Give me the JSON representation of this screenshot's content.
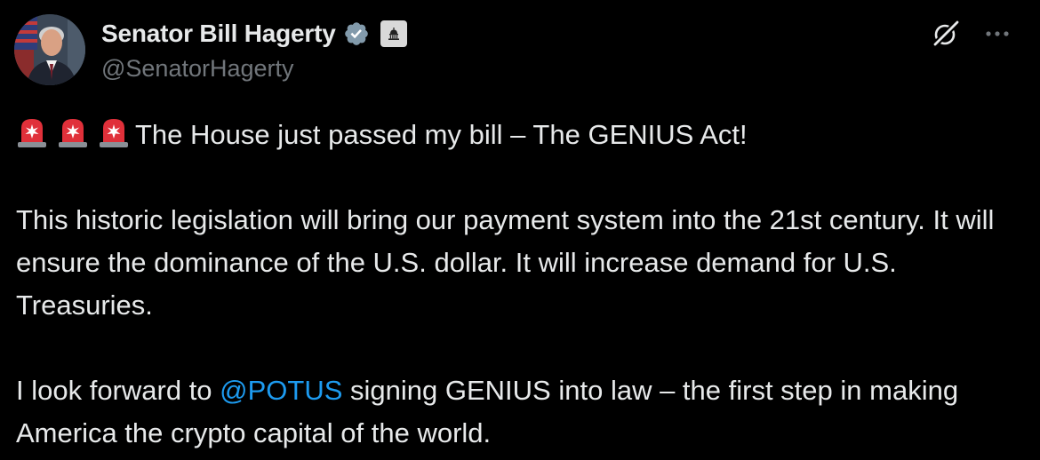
{
  "tweet": {
    "display_name": "Senator Bill Hagerty",
    "handle": "@SenatorHagerty",
    "icons": {
      "verified": "verified-badge-icon",
      "affiliation": "capitol-building-icon",
      "grok": "grok-icon",
      "more": "more-horizontal-icon",
      "siren": "rotating-light-emoji"
    },
    "line1": "The House just passed my bill – The GENIUS Act!",
    "para2": "This historic legislation will bring our payment system into the 21st century. It will ensure the dominance of the U.S. dollar. It will increase demand for U.S. Treasuries.",
    "para3_before": "I look forward to ",
    "mention": "@POTUS",
    "para3_after": " signing GENIUS into law – the first step in making America the crypto capital of the world."
  },
  "colors": {
    "background": "#000000",
    "text": "#e7e9ea",
    "secondary": "#71767b",
    "link": "#1d9bf0",
    "verified_badge": "#829aab"
  }
}
